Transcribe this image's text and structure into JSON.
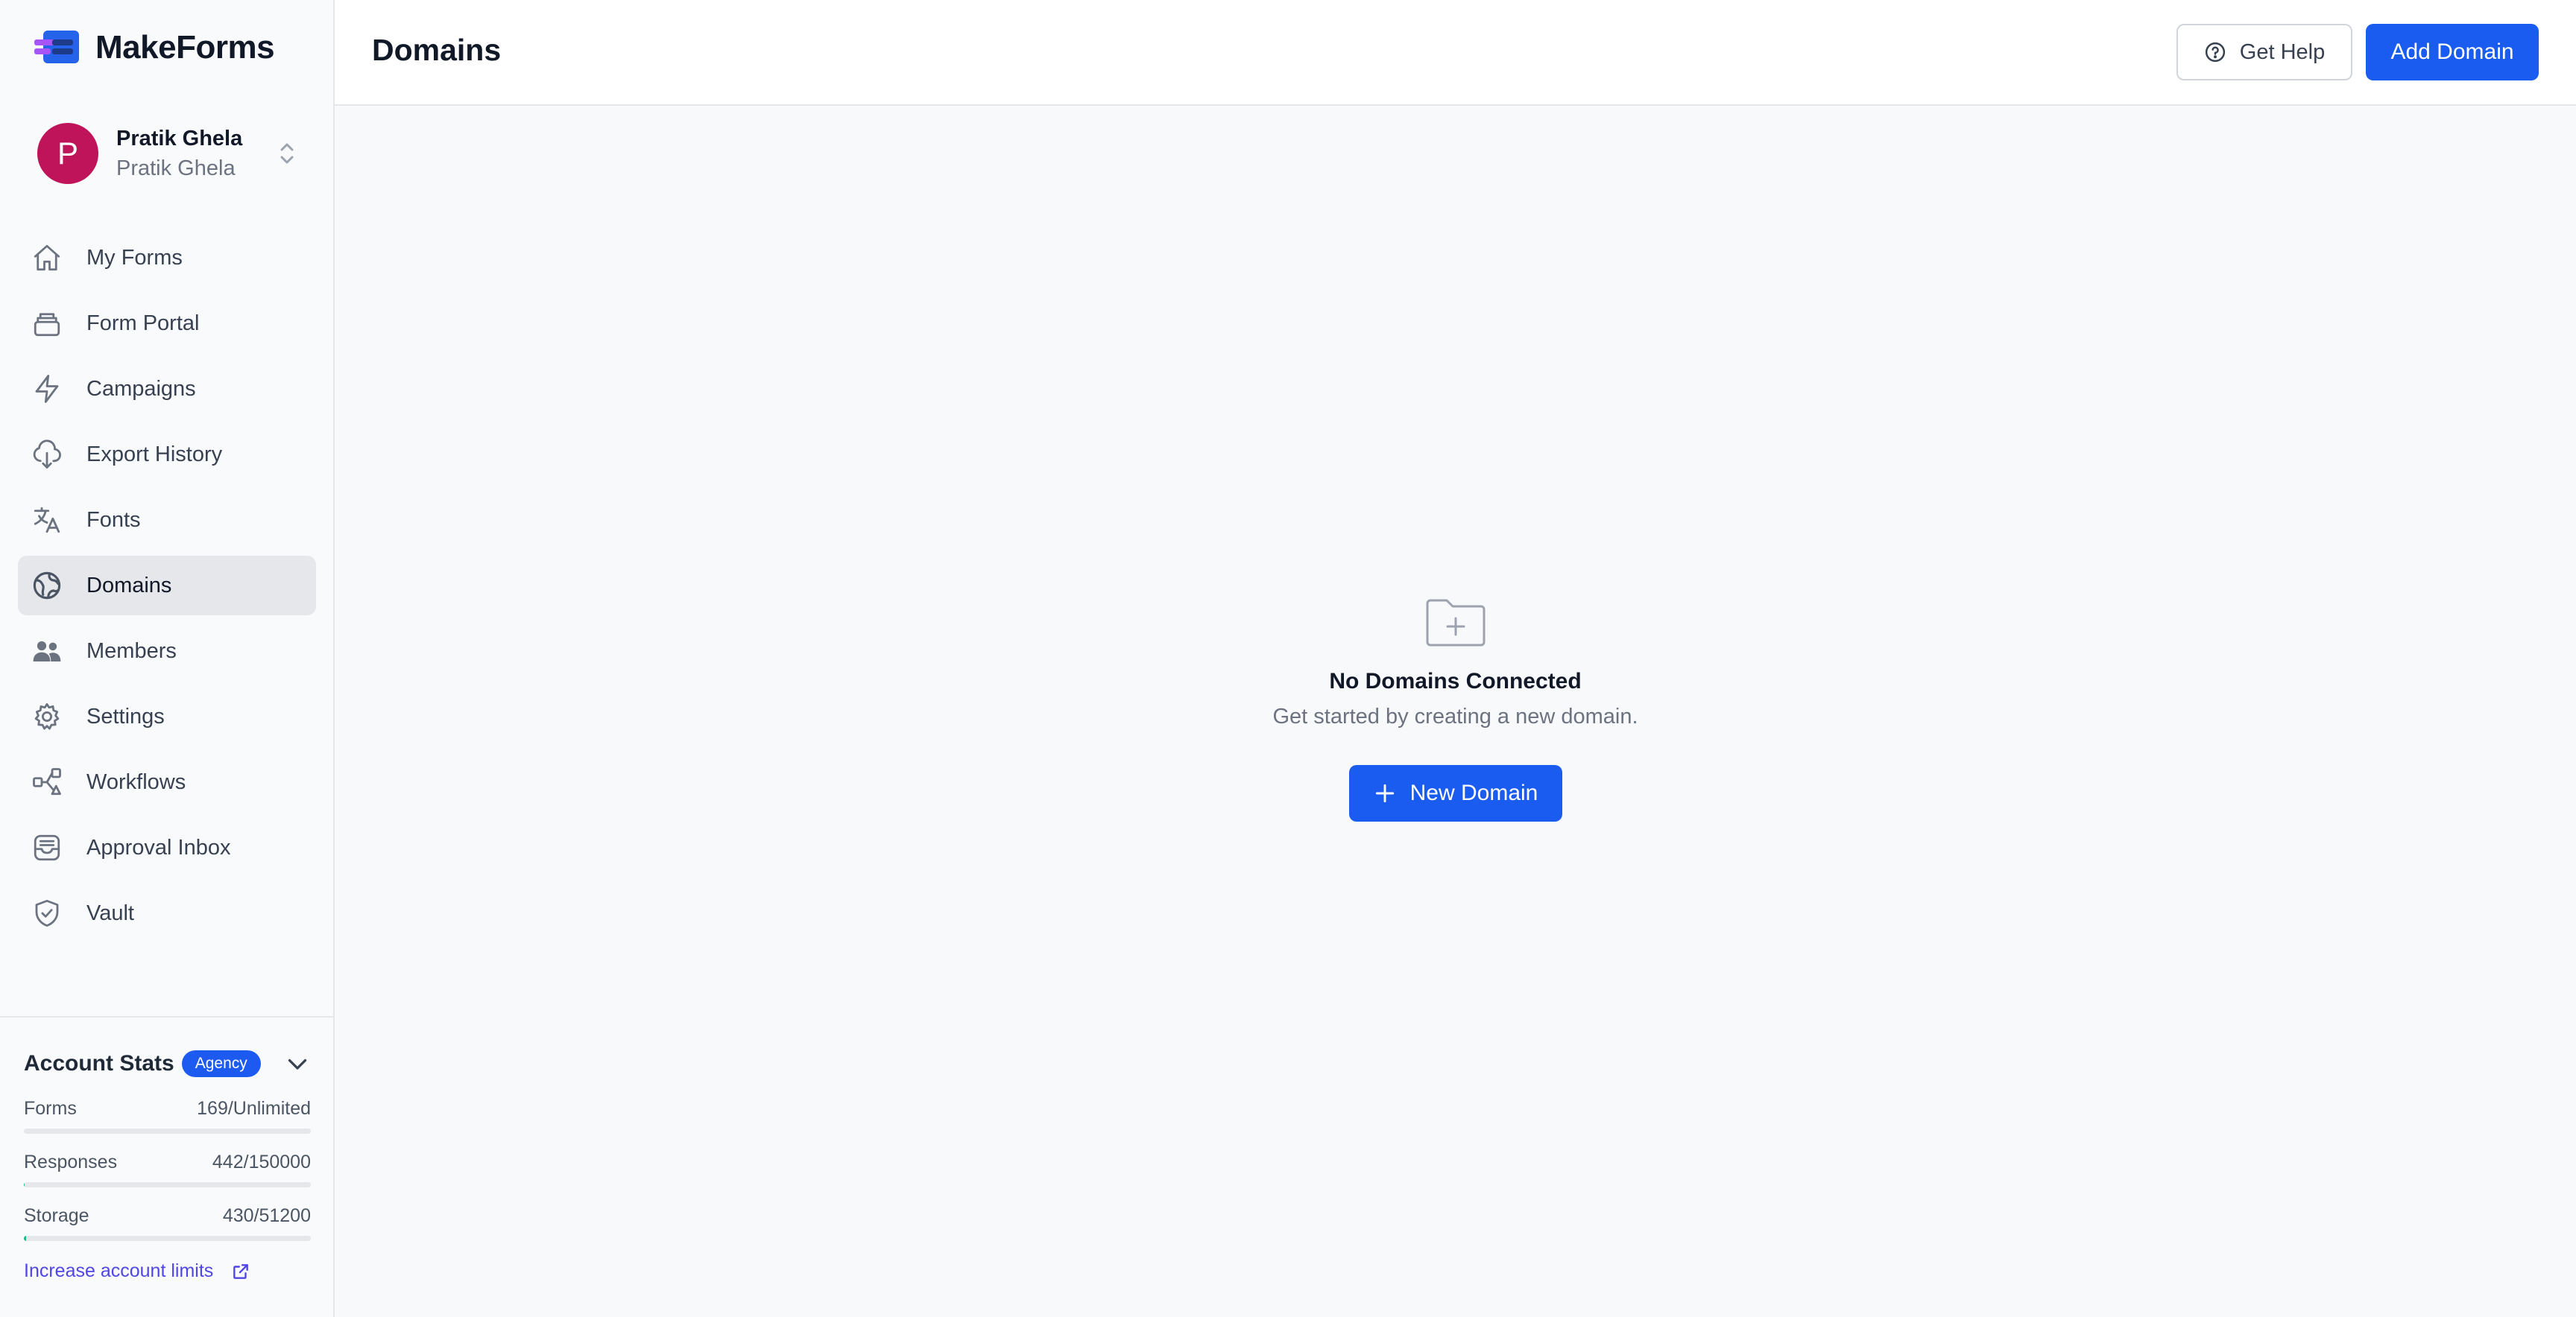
{
  "brand": {
    "name": "MakeForms",
    "logo_icon": "stack-icon"
  },
  "user": {
    "initial": "P",
    "name": "Pratik Ghela",
    "workspace": "Pratik Ghela",
    "avatar_color": "#c0145a"
  },
  "sidebar": {
    "items": [
      {
        "label": "My Forms",
        "icon": "home-icon",
        "active": false
      },
      {
        "label": "Form Portal",
        "icon": "layers-icon",
        "active": false
      },
      {
        "label": "Campaigns",
        "icon": "lightning-icon",
        "active": false
      },
      {
        "label": "Export History",
        "icon": "cloud-download-icon",
        "active": false
      },
      {
        "label": "Fonts",
        "icon": "translate-icon",
        "active": false
      },
      {
        "label": "Domains",
        "icon": "globe-icon",
        "active": true
      },
      {
        "label": "Members",
        "icon": "users-icon",
        "active": false
      },
      {
        "label": "Settings",
        "icon": "gear-icon",
        "active": false
      },
      {
        "label": "Workflows",
        "icon": "workflow-icon",
        "active": false
      },
      {
        "label": "Approval Inbox",
        "icon": "inbox-icon",
        "active": false
      },
      {
        "label": "Vault",
        "icon": "shield-icon",
        "active": false
      }
    ]
  },
  "stats": {
    "title": "Account Stats",
    "plan": "Agency",
    "rows": [
      {
        "label": "Forms",
        "value": "169/Unlimited",
        "fraction": 0
      },
      {
        "label": "Responses",
        "value": "442/150000",
        "fraction": 0.003
      },
      {
        "label": "Storage",
        "value": "430/51200",
        "fraction": 0.008
      }
    ],
    "limits_link": "Increase account limits"
  },
  "header": {
    "title": "Domains",
    "help_label": "Get Help",
    "add_label": "Add Domain"
  },
  "empty": {
    "title": "No Domains Connected",
    "subtitle": "Get started by creating a new domain.",
    "button_label": "New Domain"
  },
  "colors": {
    "accent": "#1a5cf0",
    "progress": "#10b981",
    "link": "#4f46e5"
  }
}
